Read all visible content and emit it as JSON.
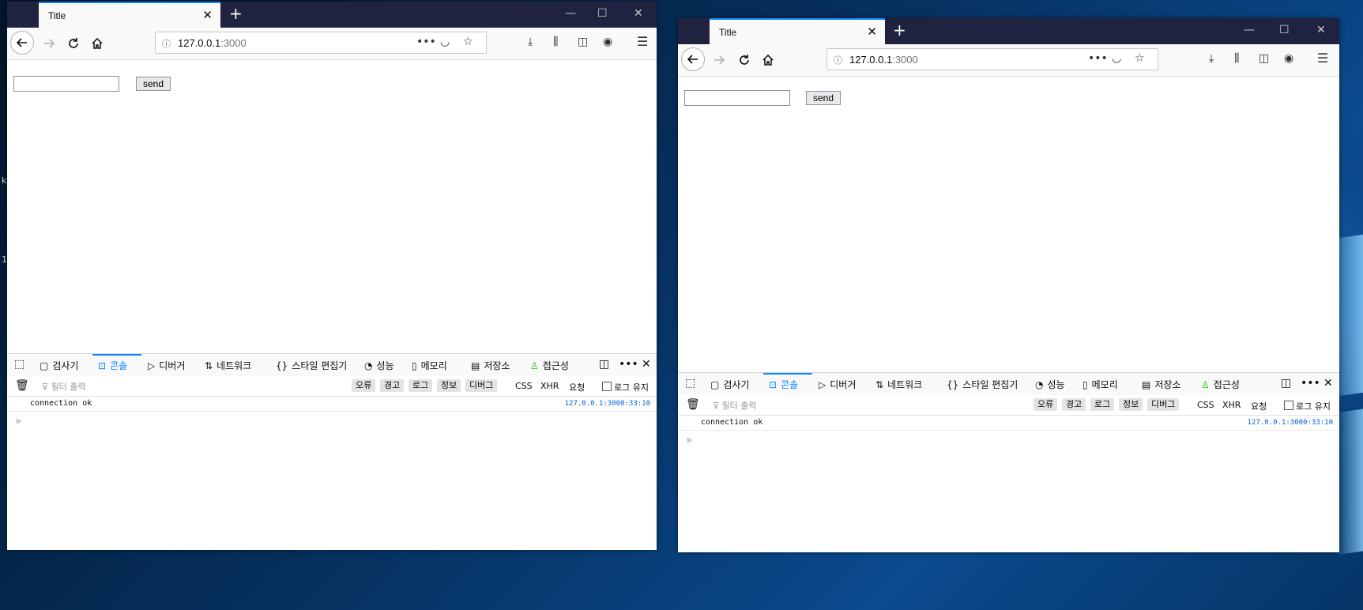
{
  "window_left": {
    "tab_title": "Title",
    "url": {
      "host": "127.0.0.1",
      "port": ":3000"
    },
    "send_label": "send"
  },
  "window_right": {
    "tab_title": "Title",
    "url": {
      "host": "127.0.0.1",
      "port": ":3000"
    },
    "send_label": "send"
  },
  "devtools": {
    "tabs": [
      "검사기",
      "콘솔",
      "디버거",
      "네트워크",
      "스타일 편집기",
      "성능",
      "메모리",
      "저장소",
      "접근성"
    ],
    "active_tab": "콘솔",
    "filter_placeholder": "필터 출력",
    "filter_buttons": [
      "오류",
      "경고",
      "로그",
      "정보",
      "디버그"
    ],
    "type_filters": [
      "CSS",
      "XHR",
      "요청"
    ],
    "persist_logs": "로그 유지",
    "message": "connection ok",
    "message_location": "127.0.0.1:3000:33:10",
    "prompt": "»"
  },
  "icons": {
    "back": "arrow-left",
    "forward": "arrow-right",
    "reload": "reload",
    "home": "home",
    "info": "info",
    "more": "more",
    "pocket": "pocket",
    "star": "star",
    "download": "download",
    "library": "library",
    "sidebar": "sidebar",
    "account": "account",
    "menu": "hamburger"
  },
  "colors": {
    "accent": "#0a84ff",
    "titlebar": "#202340",
    "link": "#0060df"
  }
}
